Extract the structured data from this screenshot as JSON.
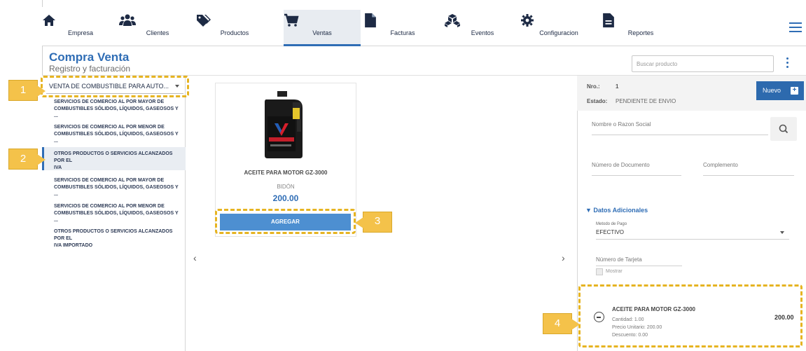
{
  "nav": {
    "items": [
      {
        "label": "Empresa",
        "icon": "home-icon"
      },
      {
        "label": "Clientes",
        "icon": "users-icon"
      },
      {
        "label": "Productos",
        "icon": "tag-icon"
      },
      {
        "label": "Ventas",
        "icon": "cart-icon",
        "active": true
      },
      {
        "label": "Facturas",
        "icon": "file-icon"
      },
      {
        "label": "Eventos",
        "icon": "cubes-icon"
      },
      {
        "label": "Configuracion",
        "icon": "gear-icon"
      },
      {
        "label": "Reportes",
        "icon": "report-icon"
      }
    ],
    "accent": "#2f6db5"
  },
  "header": {
    "title": "Compra Venta",
    "subtitle": "Registro y facturación",
    "search_placeholder": "Buscar producto"
  },
  "sidebar": {
    "selected_activity": "VENTA DE COMBUSTIBLE PARA AUTO...",
    "categories": [
      {
        "line1": "SERVICIOS DE COMERCIO AL POR MAYOR DE",
        "line2": "COMBUSTIBLES SÓLIDOS, LÍQUIDOS, GASEOSOS Y ..."
      },
      {
        "line1": "SERVICIOS DE COMERCIO AL POR MENOR DE",
        "line2": "COMBUSTIBLES SÓLIDOS, LÍQUIDOS, GASEOSOS Y ..."
      },
      {
        "line1": "OTROS PRODUCTOS O SERVICIOS ALCANZADOS POR EL",
        "line2": "IVA",
        "active": true
      },
      {
        "line1": "SERVICIOS DE COMERCIO AL POR MAYOR DE",
        "line2": "COMBUSTIBLES SÓLIDOS, LÍQUIDOS, GASEOSOS Y ..."
      },
      {
        "line1": "SERVICIOS DE COMERCIO AL POR MENOR DE",
        "line2": "COMBUSTIBLES SÓLIDOS, LÍQUIDOS, GASEOSOS Y ..."
      },
      {
        "line1": "OTROS PRODUCTOS O SERVICIOS ALCANZADOS POR EL",
        "line2": "IVA IMPORTADO"
      }
    ]
  },
  "product": {
    "name": "ACEITE PARA MOTOR GZ-3000",
    "unit": "BIDÓN",
    "price": "200.00",
    "add_label": "AGREGAR",
    "image_text": "Valvoline"
  },
  "sale": {
    "nro_label": "Nro.:",
    "nro_value": "1",
    "estado_label": "Estado:",
    "estado_value": "PENDIENTE DE ENVIO",
    "nuevo_label": "Nuevo",
    "nombre_placeholder": "Nombre o Razon Social",
    "documento_placeholder": "Número de Documento",
    "complemento_placeholder": "Complemento",
    "datos_label": "▼ Datos Adicionales",
    "metodo_label": "Metodo de Pago",
    "metodo_value": "EFECTIVO",
    "tarjeta_placeholder": "Número de Tarjeta",
    "mostrar_label": "Mostrar"
  },
  "cart": {
    "name": "ACEITE PARA MOTOR GZ-3000",
    "cantidad": "Cantidad: 1.00",
    "precio_unitario": "Precio Unitario: 200.00",
    "descuento": "Descuento: 0.00",
    "total": "200.00"
  },
  "callouts": [
    "1",
    "2",
    "3",
    "4"
  ],
  "callout_color": "#f4c24a"
}
